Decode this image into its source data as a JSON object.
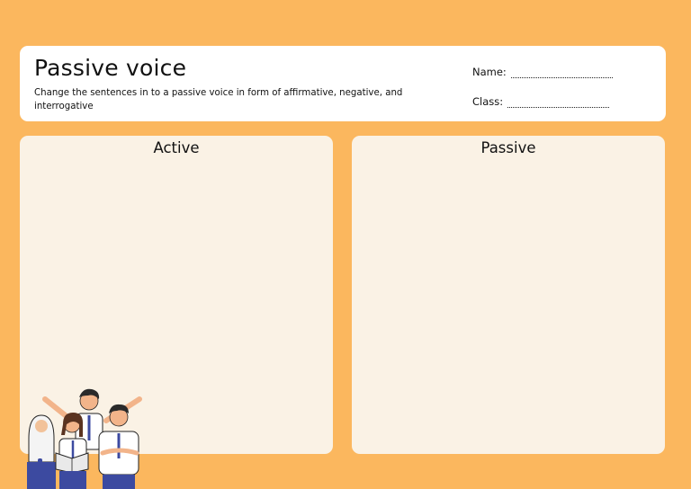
{
  "header": {
    "title": "Passive voice",
    "instructions": "Change the sentences in to a passive voice in form of affirmative, negative, and interrogative",
    "name_label": "Name:",
    "class_label": "Class:"
  },
  "panels": {
    "active_title": "Active",
    "passive_title": "Passive"
  },
  "illustration": {
    "icon": "students-group-illustration"
  },
  "colors": {
    "background": "#fbb75e",
    "card": "#ffffff",
    "panel": "#faf2e5",
    "uniform_navy": "#3c4aa0"
  }
}
